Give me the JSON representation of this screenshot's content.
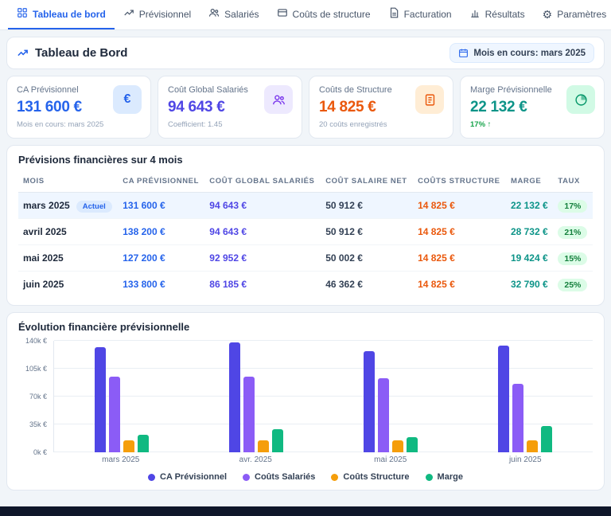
{
  "nav": {
    "items": [
      {
        "label": "Tableau de bord",
        "active": true
      },
      {
        "label": "Prévisionnel"
      },
      {
        "label": "Salariés"
      },
      {
        "label": "Coûts de structure"
      },
      {
        "label": "Facturation"
      },
      {
        "label": "Résultats"
      },
      {
        "label": "Paramètres"
      }
    ]
  },
  "header": {
    "title": "Tableau de Bord",
    "period_chip": "Mois en cours: mars 2025"
  },
  "kpis": [
    {
      "label": "CA Prévisionnel",
      "value": "131 600 €",
      "sub": "Mois en cours: mars 2025",
      "color": "#2563eb"
    },
    {
      "label": "Coût Global Salariés",
      "value": "94 643 €",
      "sub": "Coefficient: 1.45",
      "color": "#4f46e5"
    },
    {
      "label": "Coûts de Structure",
      "value": "14 825 €",
      "sub": "20 coûts enregistrés",
      "color": "#ea580c"
    },
    {
      "label": "Marge Prévisionnelle",
      "value": "22 132 €",
      "sub": "17% ↑",
      "color": "#0d9488"
    }
  ],
  "table": {
    "title": "Prévisions financières sur 4 mois",
    "columns": [
      "Mois",
      "CA Prévisionnel",
      "Coût Global Salariés",
      "Coût Salaire Net",
      "Coûts Structure",
      "Marge",
      "Taux"
    ],
    "rows": [
      {
        "cells": [
          "mars 2025",
          "131 600 €",
          "94 643 €",
          "50 912 €",
          "14 825 €",
          "22 132 €",
          "17%"
        ],
        "badge": "Actuel",
        "current": true
      },
      {
        "cells": [
          "avril 2025",
          "138 200 €",
          "94 643 €",
          "50 912 €",
          "14 825 €",
          "28 732 €",
          "21%"
        ],
        "current": false
      },
      {
        "cells": [
          "mai 2025",
          "127 200 €",
          "92 952 €",
          "50 002 €",
          "14 825 €",
          "19 424 €",
          "15%"
        ],
        "current": false
      },
      {
        "cells": [
          "juin 2025",
          "133 800 €",
          "86 185 €",
          "46 362 €",
          "14 825 €",
          "32 790 €",
          "25%"
        ],
        "current": false
      }
    ]
  },
  "chart_data": {
    "type": "bar",
    "title": "Évolution financière prévisionnelle",
    "categories": [
      "mars 2025",
      "avr. 2025",
      "mai 2025",
      "juin 2025"
    ],
    "series": [
      {
        "name": "CA Prévisionnel",
        "color": "#4f46e5",
        "values": [
          131600,
          138200,
          127200,
          133800
        ]
      },
      {
        "name": "Coûts Salariés",
        "color": "#8b5cf6",
        "values": [
          94643,
          94643,
          92952,
          86185
        ]
      },
      {
        "name": "Coûts Structure",
        "color": "#f59e0b",
        "values": [
          14825,
          14825,
          14825,
          14825
        ]
      },
      {
        "name": "Marge",
        "color": "#10b981",
        "values": [
          22132,
          28732,
          19424,
          32790
        ]
      }
    ],
    "ylim": [
      0,
      140000
    ],
    "yticks": [
      "0k €",
      "35k €",
      "70k €",
      "105k €",
      "140k €"
    ],
    "grid": true,
    "legend_position": "bottom"
  }
}
